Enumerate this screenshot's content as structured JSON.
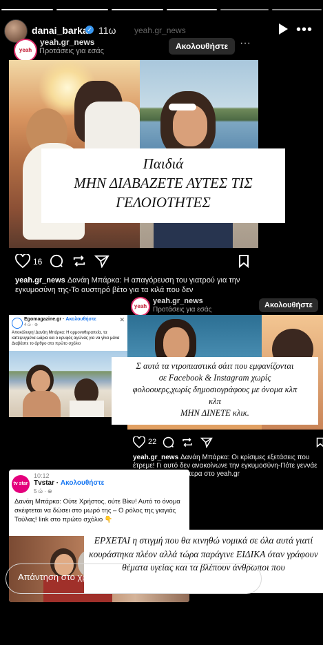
{
  "story": {
    "username": "danai_barka",
    "age": "11ω",
    "faded_text": "yeah.gr_news",
    "reply_placeholder": "Απάντηση στο χρήστη danai_barka..."
  },
  "post1": {
    "username": "yeah.gr_news",
    "subtitle": "Προτάσεις για εσάς",
    "follow_label": "Ακολουθήστε",
    "avatar_text": "yeah",
    "overlay": "Παιδιά\nΜΗΝ ΔΙΑΒΑΖΕΤΕ ΑΥΤΕΣ ΤΙΣ\nΓΕΛΟΙΟΤΗΤΕΣ",
    "likes": "16",
    "caption_user": "yeah.gr_news",
    "caption_text": "Δανάη Μπάρκα: Η απαγόρευση του γιατρού για την εγκυμοσύνη της-Το αυστηρό βέτο για τα κιλά που δεν"
  },
  "post2": {
    "username": "yeah.gr_news",
    "subtitle": "Προτάσεις για εσάς",
    "follow_label": "Ακολουθήστε",
    "avatar_text": "yeah",
    "overlay": "Σ αυτά τα ντροπιαστικά σάιτ που εμφανίζονται\nσε Facebook & Instagram χωρίς\nφολοουερς,χωρίς δημοσιογράφους με όνομα κλπ\nκλπ\nΜΗΝ ΔΙΝΕΤΕ κλικ.",
    "likes": "22",
    "caption_user": "yeah.gr_news",
    "caption_text": "Δανάη Μπάρκα: Οι κρίσιμες εξετάσεις που έτρεμε! Γι αυτό δεν ανακοίνωνε την εγκυμοσύνη-Πότε γεννάε Διαβάστε περισσότερα στο yeah.gr"
  },
  "fb_card": {
    "page_name": "Egomagazine.gr",
    "follow": "Ακολουθήστε",
    "time": "4 ώ · ⊕",
    "text": "Αποκάλυψη! Δανάη Μπάρκα: Η ορμονοθεραπεία, τα κατεψυγμένα ωάρια και ο κρυφός αγώνας για να γίνει μάνα Διαβάστε το άρθρο στο πρώτο σχόλιο"
  },
  "tvstar_card": {
    "logo": "tv star",
    "page_name": "Tvstar",
    "follow": "Ακολουθήστε",
    "time": "5 ώ · ⊕",
    "clock": "10:12",
    "text": "Δανάη Μπάρκα: Ούτε Χρήστος, ούτε Βίκυ! Αυτό το όνομα σκέφτεται να δώσει στο μωρό της – Ο ρόλος της γιαγιάς Τούλας! link στο πρώτο σχόλιο 👇"
  },
  "bottom_overlay": "ΕΡΧΕΤΑΙ η στιγμή που θα κινηθώ νομικά σε όλα αυτά γιατί κουράστηκα πλέον αλλά τώρα παράγινε ΕΙΔΙΚΑ όταν γράφουν θέματα υγείας και τα βλέπουν άνθρωποι που",
  "colors": {
    "background": "#000000",
    "follow_bg": "#2a2a2a",
    "link_blue": "#1877f2",
    "verified": "#3897f0"
  }
}
